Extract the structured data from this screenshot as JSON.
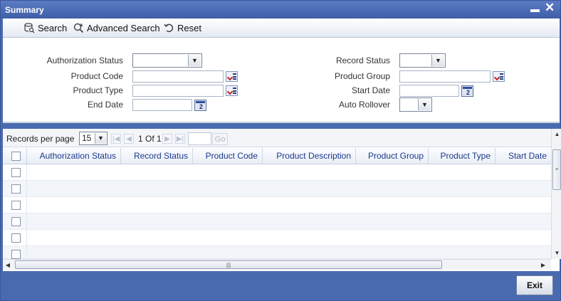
{
  "window": {
    "title": "Summary"
  },
  "toolbar": {
    "search": "Search",
    "advanced_search": "Advanced Search",
    "reset": "Reset"
  },
  "criteria": {
    "authorization_status": {
      "label": "Authorization Status",
      "value": ""
    },
    "record_status": {
      "label": "Record Status",
      "value": ""
    },
    "product_code": {
      "label": "Product Code",
      "value": ""
    },
    "product_group": {
      "label": "Product Group",
      "value": ""
    },
    "product_type": {
      "label": "Product Type",
      "value": ""
    },
    "start_date": {
      "label": "Start Date",
      "value": ""
    },
    "end_date": {
      "label": "End Date",
      "value": ""
    },
    "auto_rollover": {
      "label": "Auto Rollover",
      "value": ""
    }
  },
  "pager": {
    "records_per_page_label": "Records per page",
    "records_per_page": "15",
    "page_info": "1 Of 1",
    "go": "Go"
  },
  "grid": {
    "columns": [
      "Authorization Status",
      "Record Status",
      "Product Code",
      "Product Description",
      "Product Group",
      "Product Type",
      "Start Date"
    ],
    "visible_rows": 6
  },
  "footer": {
    "exit": "Exit"
  },
  "icons": {
    "search": "search-icon",
    "advanced_search": "advanced-search-icon",
    "reset": "reset-icon",
    "lov": "list-of-values-icon",
    "calendar": "calendar-icon"
  },
  "colors": {
    "title_bar": "#4a6ab0",
    "header_text": "#1d3a8a"
  }
}
